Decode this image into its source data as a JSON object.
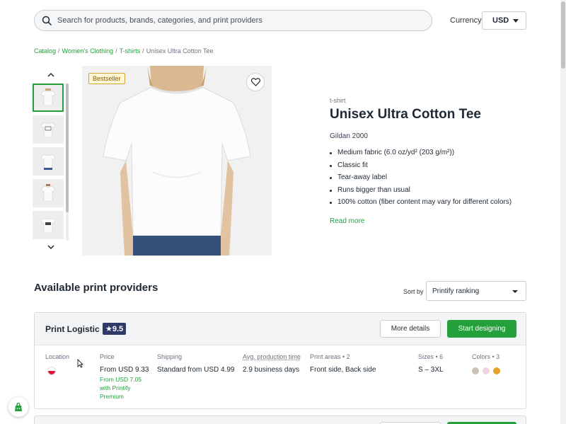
{
  "header": {
    "search_placeholder": "Search for products, brands, categories, and print providers",
    "currency_label": "Currency",
    "currency_value": "USD"
  },
  "breadcrumb": {
    "items": [
      "Catalog",
      "Women's Clothing",
      "T-shirts"
    ],
    "current": "Unisex Ultra Cotton Tee"
  },
  "gallery": {
    "badge": "Bestseller",
    "thumbnail_count": 5,
    "active_thumbnail": 0,
    "icons": [
      "chevron-up-icon",
      "chevron-down-icon",
      "heart-icon"
    ]
  },
  "product": {
    "category": "t-shirt",
    "title": "Unisex Ultra Cotton Tee",
    "model": "Gildan 2000",
    "features": [
      "Medium fabric (6.0 oz/yd² (203 g/m²))",
      "Classic fit",
      "Tear-away label",
      "Runs bigger than usual",
      "100% cotton (fiber content may vary for different colors)"
    ],
    "read_more": "Read more"
  },
  "providers": {
    "section_title": "Available print providers",
    "sort_label": "Sort by",
    "sort_value": "Printify ranking",
    "list": [
      {
        "name": "Print Logistic",
        "rating": "9.5",
        "more_details": "More details",
        "start_designing": "Start designing",
        "columns": {
          "location_label": "Location",
          "price_label": "Price",
          "price_value": "From USD 9.33",
          "premium_note": "From USD 7.05 with Printify Premium",
          "shipping_label": "Shipping",
          "shipping_value": "Standard from USD 4.99",
          "production_label": "Avg. production time",
          "production_value": "2.9 business days",
          "print_areas_label": "Print areas • 2",
          "print_areas_value": "Front side, Back side",
          "sizes_label": "Sizes • 6",
          "sizes_value": "S – 3XL",
          "colors_label": "Colors • 3"
        },
        "colors": [
          "#c9c2b4",
          "#f0d4dc",
          "#e7a12a"
        ],
        "flag_colors": [
          "#ffffff",
          "#dc143c"
        ]
      }
    ]
  },
  "theme": {
    "accent": "#23a03b",
    "rating_bg": "#2f3a66"
  }
}
